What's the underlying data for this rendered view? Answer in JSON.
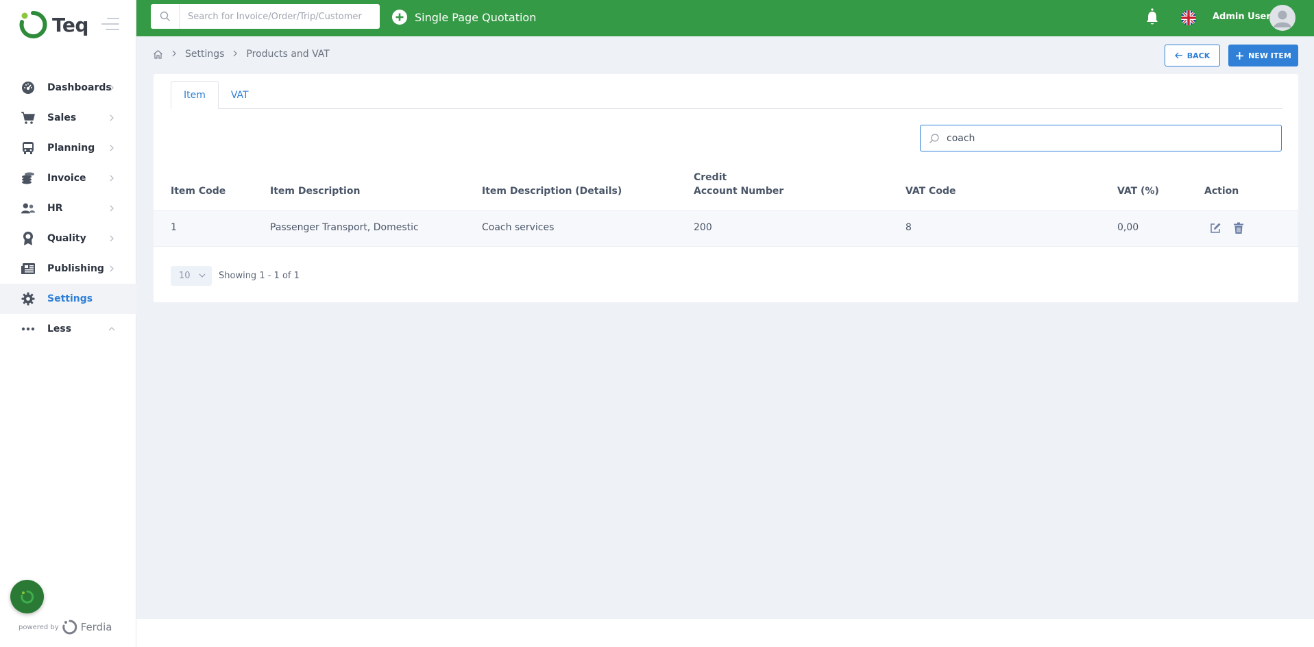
{
  "brand": {
    "name": "Teq"
  },
  "sidebar": {
    "items": [
      {
        "label": "Dashboards",
        "icon": "dashboard-icon"
      },
      {
        "label": "Sales",
        "icon": "cart-icon"
      },
      {
        "label": "Planning",
        "icon": "bus-icon"
      },
      {
        "label": "Invoice",
        "icon": "coins-icon"
      },
      {
        "label": "HR",
        "icon": "users-icon"
      },
      {
        "label": "Quality",
        "icon": "award-icon"
      },
      {
        "label": "Publishing",
        "icon": "newspaper-icon"
      },
      {
        "label": "Settings",
        "icon": "gear-icon",
        "active": true
      },
      {
        "label": "Less",
        "icon": "ellipsis-icon"
      }
    ],
    "powered_by": "powered by",
    "powered_brand": "Ferdia"
  },
  "topbar": {
    "search_placeholder": "Search for Invoice/Order/Trip/Customer",
    "quick_action": "Single Page Quotation",
    "user_name": "Admin User",
    "color": "#359a45"
  },
  "breadcrumb": {
    "items": [
      "Settings",
      "Products and VAT"
    ]
  },
  "actions": {
    "back": "BACK",
    "new_item": "NEW ITEM"
  },
  "tabs": [
    {
      "label": "Item",
      "active": true
    },
    {
      "label": "VAT",
      "active": false
    }
  ],
  "filter": {
    "value": "coach"
  },
  "table": {
    "headers": {
      "item_code": "Item Code",
      "item_description": "Item Description",
      "item_description_details": "Item Description (Details)",
      "credit_line1": "Credit",
      "credit_line2": "Account Number",
      "vat_code": "VAT Code",
      "vat_percent": "VAT (%)",
      "action": "Action"
    },
    "rows": [
      {
        "item_code": "1",
        "item_description": "Passenger Transport, Domestic",
        "item_description_details": "Coach services",
        "credit_account_number": "200",
        "vat_code": "8",
        "vat_percent": "0,00"
      }
    ]
  },
  "pagination": {
    "page_size": "10",
    "showing": "Showing 1 - 1 of 1"
  },
  "colors": {
    "accent": "#2f80d6",
    "brand_green": "#359a45"
  }
}
